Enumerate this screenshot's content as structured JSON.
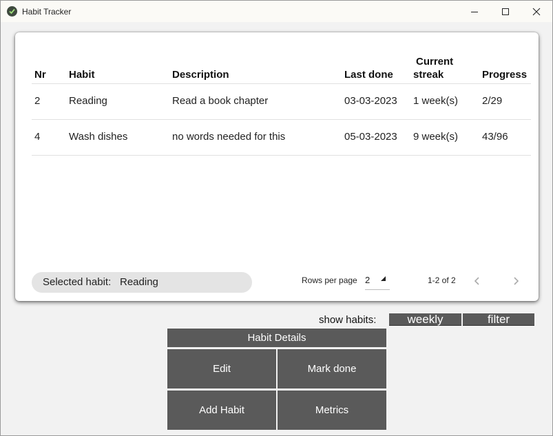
{
  "window": {
    "title": "Habit Tracker"
  },
  "table": {
    "headers": {
      "nr": "Nr",
      "habit": "Habit",
      "description": "Description",
      "last_done": "Last done",
      "streak_line1": "Current",
      "streak_line2": "streak",
      "progress": "Progress"
    },
    "rows": [
      {
        "nr": "2",
        "habit": "Reading",
        "description": "Read a book chapter",
        "last_done": "03-03-2023",
        "streak": "1 week(s)",
        "progress": "2/29"
      },
      {
        "nr": "4",
        "habit": "Wash dishes",
        "description": "no words needed for this",
        "last_done": "05-03-2023",
        "streak": "9 week(s)",
        "progress": "43/96"
      }
    ]
  },
  "footer": {
    "selected_label": "Selected habit:",
    "selected_value": "Reading",
    "rows_per_page_label": "Rows per page",
    "rows_per_page_value": "2",
    "range_text": "1-2 of 2"
  },
  "filters": {
    "show_label": "show habits:",
    "periodicity": "weekly",
    "filter": "filter"
  },
  "actions": {
    "details": "Habit Details",
    "edit": "Edit",
    "mark_done": "Mark done",
    "add": "Add Habit",
    "metrics": "Metrics"
  },
  "colors": {
    "button_bg": "#5a5a5a",
    "app_bg": "#f2f2f2",
    "selected_pill": "#e4e4e4"
  }
}
